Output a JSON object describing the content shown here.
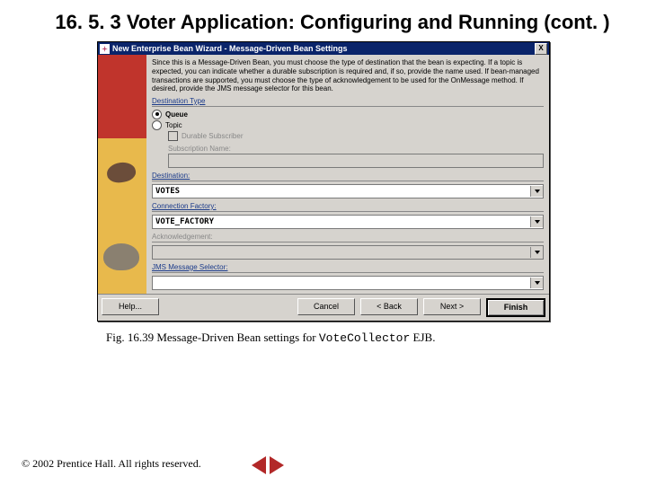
{
  "slide": {
    "title": "16. 5. 3   Voter Application: Configuring and Running (cont. )"
  },
  "dialog": {
    "title": "New Enterprise Bean Wizard - Message-Driven Bean Settings",
    "close": "X",
    "instructions": "Since this is a Message-Driven Bean, you must choose the type of destination that the bean is expecting. If a topic is expected, you can indicate whether a durable subscription is required and, if so, provide the name used. If bean-managed transactions are supported, you must choose the type of acknowledgement to be used for the OnMessage method.\nIf desired, provide the JMS message selector for this bean.",
    "sections": {
      "destType": "Destination Type",
      "destination": "Destination:",
      "connFactory": "Connection Factory:",
      "ack": "Acknowledgement:",
      "selector": "JMS Message Selector:"
    },
    "radios": {
      "queue": "Queue",
      "topic": "Topic"
    },
    "durable": "Durable Subscriber",
    "subName": "Subscription Name:",
    "values": {
      "destination": "VOTES",
      "connFactory": "VOTE_FACTORY",
      "ack": "",
      "selector": ""
    },
    "buttons": {
      "help": "Help...",
      "cancel": "Cancel",
      "back": "< Back",
      "next": "Next >",
      "finish": "Finish"
    }
  },
  "caption": {
    "prefix": "Fig. 16.39  Message-Driven Bean settings for ",
    "code": "VoteCollector",
    "suffix": " EJB."
  },
  "footer": {
    "copyright": "© 2002 Prentice Hall. All rights reserved."
  }
}
